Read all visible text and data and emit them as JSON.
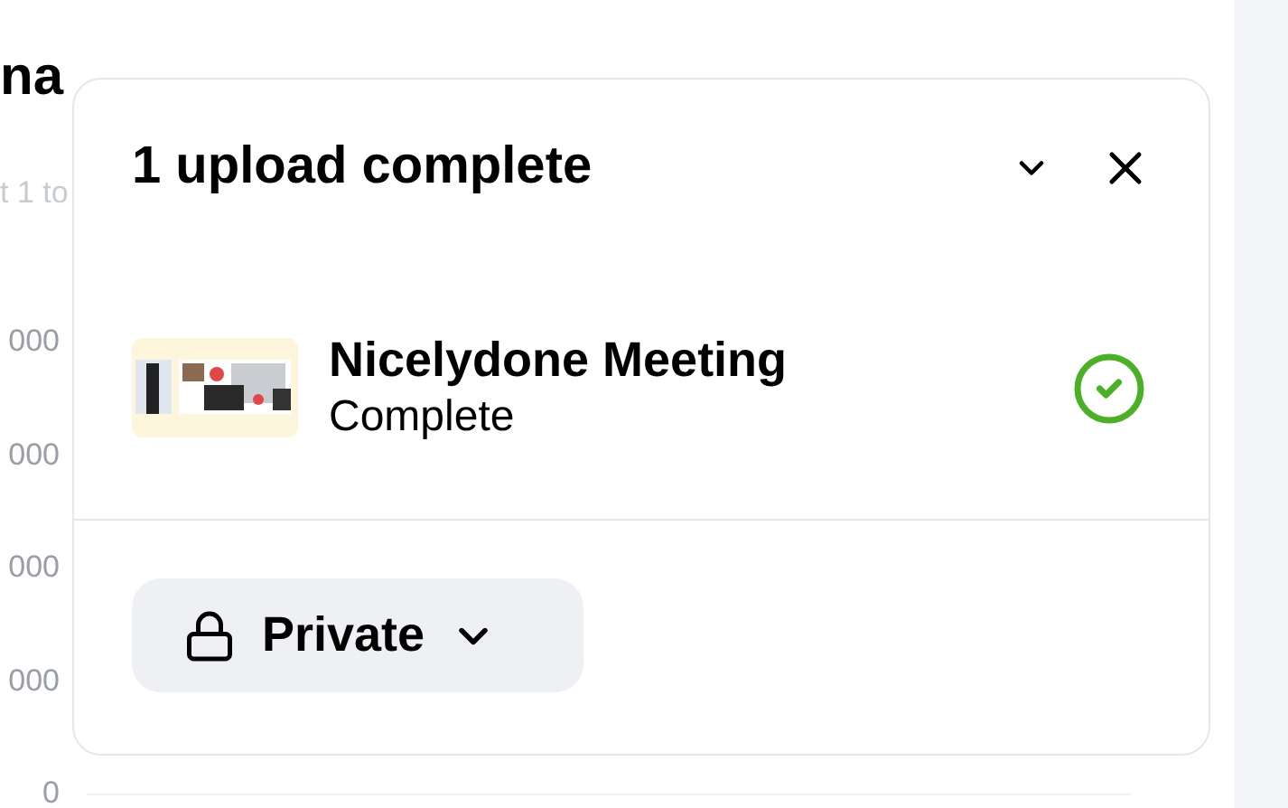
{
  "background": {
    "heading": "na",
    "subtitle": "t 1 to",
    "y_axis_labels": [
      "000",
      "000",
      "000",
      "000",
      "0"
    ]
  },
  "upload_panel": {
    "title": "1 upload complete",
    "items": [
      {
        "name": "Nicelydone Meeting",
        "status": "Complete",
        "complete": true
      }
    ],
    "visibility": {
      "label": "Private"
    }
  }
}
